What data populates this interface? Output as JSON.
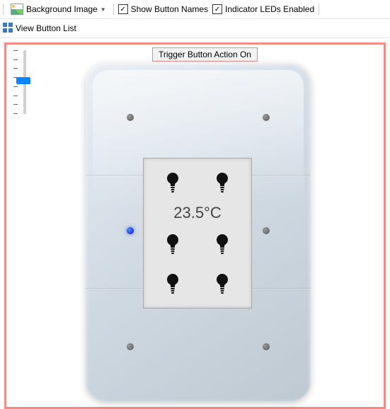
{
  "toolbar": {
    "background_image_label": "Background Image",
    "show_button_names": {
      "label": "Show Button Names",
      "checked": true
    },
    "indicator_leds": {
      "label": "Indicator LEDs Enabled",
      "checked": true
    },
    "view_button_list_label": "View Button List"
  },
  "trigger_button_label": "Trigger Button Action On",
  "screen": {
    "temperature_display": "23.5°C"
  }
}
